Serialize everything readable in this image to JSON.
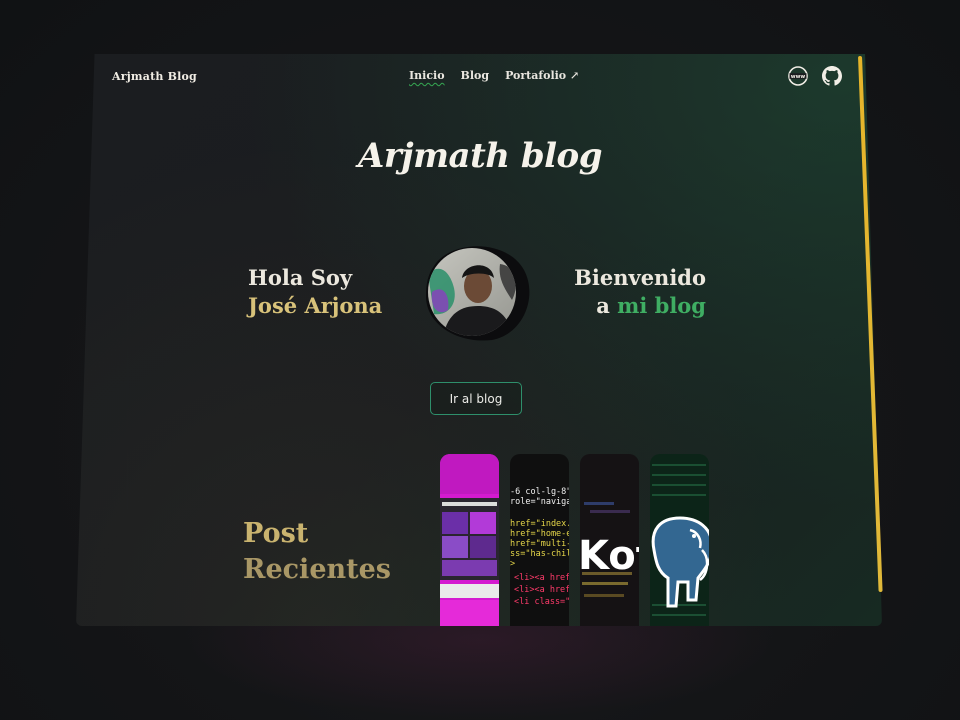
{
  "nav": {
    "brand": "Arjmath Blog",
    "items": [
      {
        "label": "Inicio",
        "active": true
      },
      {
        "label": "Blog",
        "active": false
      },
      {
        "label": "Portafolio ↗",
        "active": false
      }
    ],
    "icons": [
      "www-icon",
      "github-icon"
    ]
  },
  "hero": {
    "title": "Arjmath blog",
    "left_line1": "Hola Soy",
    "left_line2": "José Arjona",
    "right_line1": "Bienvenido",
    "right_line2_prefix": "a ",
    "right_line2_highlight": "mi blog",
    "cta_label": "Ir al blog"
  },
  "recent": {
    "line1": "Post",
    "line2": "Recientes",
    "thumb_texts": {
      "code_lines": [
        "-6 col-lg-8\">",
        "role=\"navigat",
        "href=\"index.",
        "href=\"home-e",
        "href=\"multi-",
        "ss=\"has-chil",
        ">",
        "<li><a href",
        "<li><a href",
        "<li class=\""
      ],
      "kotlin_text": "Kot"
    }
  },
  "colors": {
    "accent_green": "#3fae63",
    "accent_gold": "#d8c27a",
    "edge_yellow": "#e6b52a"
  }
}
